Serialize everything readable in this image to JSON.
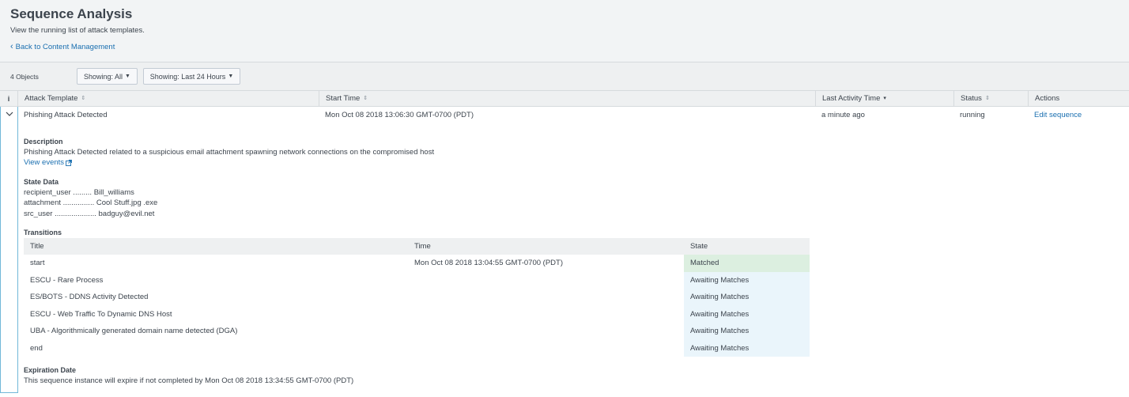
{
  "header": {
    "title": "Sequence Analysis",
    "subtitle": "View the running list of attack templates.",
    "back_link": "Back to Content Management"
  },
  "toolbar": {
    "object_count": "4 Objects",
    "filter_showing": "Showing: All",
    "filter_time": "Showing: Last 24 Hours"
  },
  "table": {
    "info_symbol": "i",
    "columns": {
      "attack_template": "Attack Template",
      "start_time": "Start Time",
      "last_activity": "Last Activity Time",
      "status": "Status",
      "actions": "Actions"
    },
    "row": {
      "attack_template": "Phishing Attack Detected",
      "start_time": "Mon Oct 08 2018 13:06:30 GMT-0700 (PDT)",
      "last_activity": "a minute ago",
      "status": "running",
      "action": "Edit sequence"
    }
  },
  "detail": {
    "description_label": "Description",
    "description": "Phishing Attack Detected related to a suspicious email attachment spawning network connections on the compromised host",
    "view_events": "View events",
    "state_data_label": "State Data",
    "state_data": [
      {
        "key": "recipient_user",
        "dots": " ......... ",
        "value": "Bill_williams"
      },
      {
        "key": "attachment",
        "dots": " ............... ",
        "value": "Cool Stuff.jpg .exe"
      },
      {
        "key": "src_user",
        "dots": " .................... ",
        "value": "badguy@evil.net"
      }
    ],
    "transitions_label": "Transitions",
    "transitions_columns": {
      "title": "Title",
      "time": "Time",
      "state": "State"
    },
    "transitions": [
      {
        "title": "start",
        "time": "Mon Oct 08 2018 13:04:55 GMT-0700 (PDT)",
        "state": "Matched"
      },
      {
        "title": "ESCU - Rare Process",
        "time": "",
        "state": "Awaiting Matches"
      },
      {
        "title": "ES/BOTS - DDNS Activity Detected",
        "time": "",
        "state": "Awaiting Matches"
      },
      {
        "title": "ESCU - Web Traffic To Dynamic DNS Host",
        "time": "",
        "state": "Awaiting Matches"
      },
      {
        "title": "UBA - Algorithmically generated domain name detected (DGA)",
        "time": "",
        "state": "Awaiting Matches"
      },
      {
        "title": "end",
        "time": "",
        "state": "Awaiting Matches"
      }
    ],
    "expiration_label": "Expiration Date",
    "expiration_text": "This sequence instance will expire if not completed by Mon Oct 08 2018 13:34:55 GMT-0700 (PDT)"
  },
  "icons": {
    "back": "chevron-left-icon",
    "expand": "chevron-down-icon",
    "external": "external-link-icon",
    "sort": "sort-icon",
    "caret": "caret-down-icon"
  },
  "colors": {
    "link": "#1a6fb0",
    "matched_bg": "#dcefe0",
    "awaiting_bg": "#eaf5fb",
    "expand_border": "#72b8d8"
  }
}
